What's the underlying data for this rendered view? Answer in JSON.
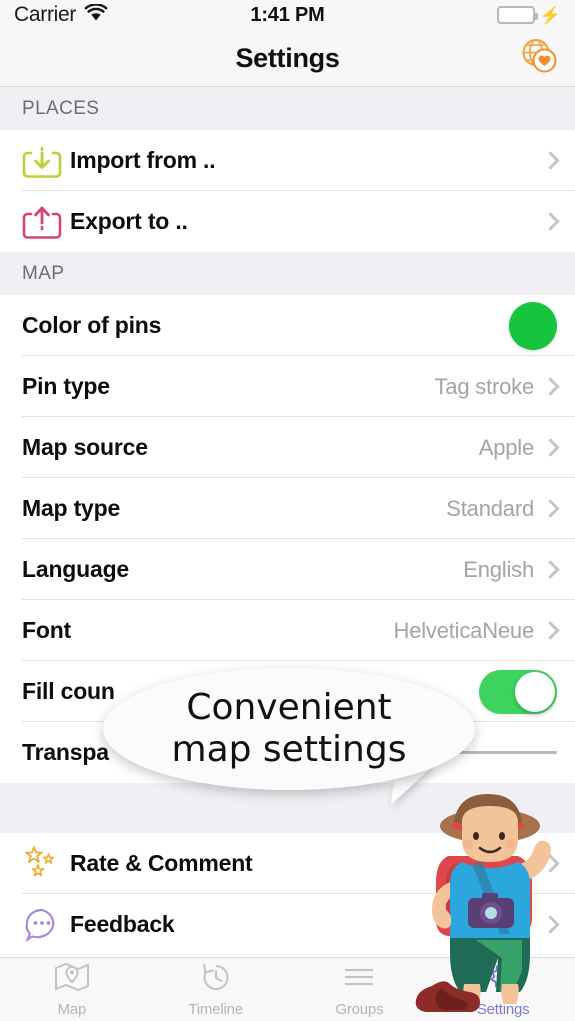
{
  "status_bar": {
    "carrier": "Carrier",
    "wifi_icon": "wifi-icon",
    "time": "1:41 PM",
    "battery_icon": "battery-icon",
    "charging_icon": "lightning-bolt-icon"
  },
  "navbar": {
    "title": "Settings",
    "right_icon": "globe-heart-icon"
  },
  "sections": [
    {
      "header": "PLACES",
      "rows": [
        {
          "icon": "import-download-icon",
          "label": "Import from ..",
          "value": "",
          "accessory": "chevron"
        },
        {
          "icon": "export-upload-icon",
          "label": "Export to ..",
          "value": "",
          "accessory": "chevron"
        }
      ]
    },
    {
      "header": "MAP",
      "rows": [
        {
          "icon": "",
          "label": "Color of pins",
          "value": "",
          "accessory": "color-swatch"
        },
        {
          "icon": "",
          "label": "Pin type",
          "value": "Tag stroke",
          "accessory": "chevron"
        },
        {
          "icon": "",
          "label": "Map source",
          "value": "Apple",
          "accessory": "chevron"
        },
        {
          "icon": "",
          "label": "Map type",
          "value": "Standard",
          "accessory": "chevron"
        },
        {
          "icon": "",
          "label": "Language",
          "value": "English",
          "accessory": "chevron"
        },
        {
          "icon": "",
          "label": "Font",
          "value": "HelveticaNeue",
          "accessory": "chevron"
        },
        {
          "icon": "",
          "label": "Fill coun",
          "value": "",
          "accessory": "toggle"
        },
        {
          "icon": "",
          "label": "Transpa",
          "value": "",
          "accessory": "slider"
        }
      ]
    },
    {
      "header": "",
      "rows": [
        {
          "icon": "stars-icon",
          "label": "Rate & Comment",
          "value": "",
          "accessory": "chevron"
        },
        {
          "icon": "chat-bubble-icon",
          "label": "Feedback",
          "value": "",
          "accessory": "chevron"
        }
      ]
    }
  ],
  "overlay": {
    "bubble_line1": "Convenient",
    "bubble_line2": "map settings",
    "character": "traveler-illustration"
  },
  "tabbar": {
    "tabs": [
      {
        "label": "Map",
        "icon": "map-pin-icon",
        "active": false
      },
      {
        "label": "Timeline",
        "icon": "clock-history-icon",
        "active": false
      },
      {
        "label": "Groups",
        "icon": "list-lines-icon",
        "active": false
      },
      {
        "label": "Settings",
        "icon": "gear-icon",
        "active": true
      }
    ]
  },
  "colors": {
    "import_icon": "#b5d334",
    "export_icon": "#d6427a",
    "pin_swatch": "#17c43e",
    "toggle_on": "#3ed35f",
    "accent_orange": "#f58f28",
    "stars": "#f0a830",
    "feedback_purple": "#a98ad6",
    "active_tab": "#7b7bd6",
    "section_bg": "#efeff4"
  }
}
